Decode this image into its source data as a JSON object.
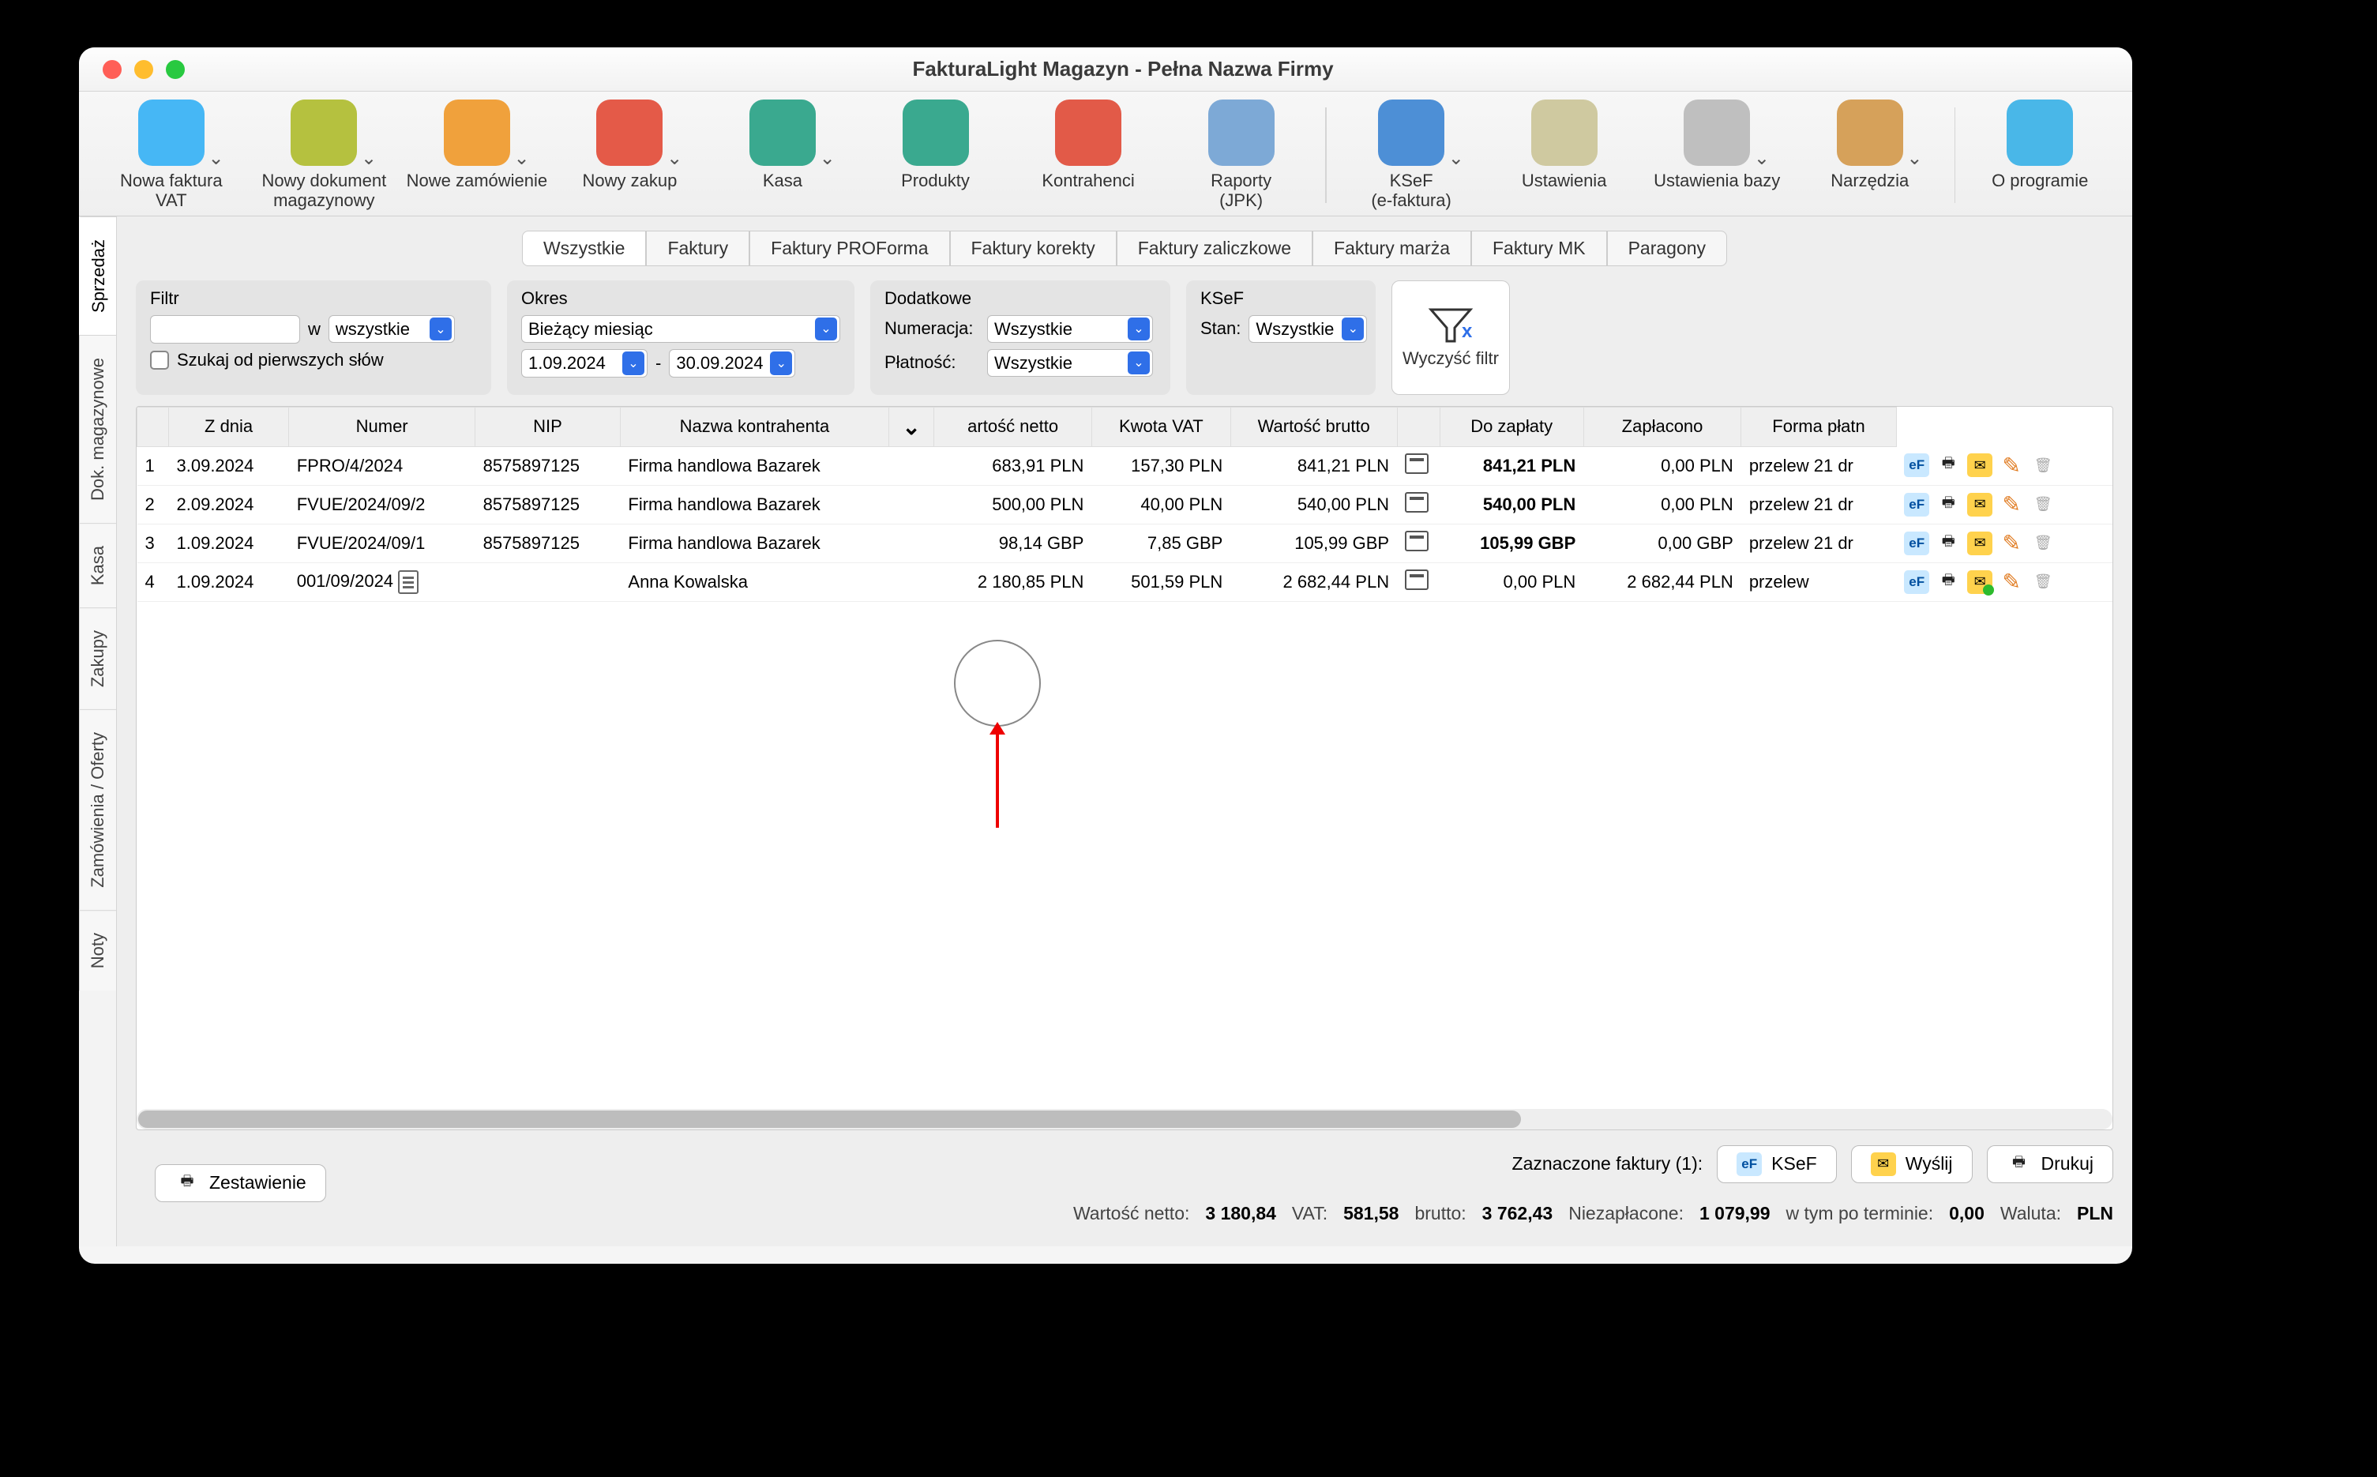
{
  "window_title": "FakturaLight Magazyn - Pełna Nazwa Firmy",
  "toolbar": [
    {
      "label": "Nowa faktura\nVAT",
      "color": "#46b7f5",
      "chev": true
    },
    {
      "label": "Nowy dokument\nmagazynowy",
      "color": "#b5c13f",
      "chev": true
    },
    {
      "label": "Nowe zamówienie",
      "color": "#f0a13c",
      "chev": true
    },
    {
      "label": "Nowy zakup",
      "color": "#e45a48",
      "chev": true
    },
    {
      "label": "Kasa",
      "color": "#3aa98f",
      "chev": true
    },
    {
      "label": "Produkty",
      "color": "#3aa98f",
      "chev": false
    },
    {
      "label": "Kontrahenci",
      "color": "#e25a48",
      "chev": false
    },
    {
      "label": "Raporty\n(JPK)",
      "color": "#7da9d6",
      "chev": false
    },
    {
      "sep": true
    },
    {
      "label": "KSeF\n(e-faktura)",
      "color": "#4d8fd6",
      "chev": true
    },
    {
      "label": "Ustawienia",
      "color": "#cfc9a0",
      "chev": false
    },
    {
      "label": "Ustawienia bazy",
      "color": "#bfbfbf",
      "chev": true
    },
    {
      "label": "Narzędzia",
      "color": "#d6a15a",
      "chev": true
    },
    {
      "sep": true
    },
    {
      "label": "O programie",
      "color": "#49b7e8",
      "chev": false
    }
  ],
  "sidetabs": [
    "Sprzedaż",
    "Dok. magazynowe",
    "Kasa",
    "Zakupy",
    "Zamówienia / Oferty",
    "Noty"
  ],
  "doc_tabs": [
    "Wszystkie",
    "Faktury",
    "Faktury PROForma",
    "Faktury korekty",
    "Faktury zaliczkowe",
    "Faktury marża",
    "Faktury MK",
    "Paragony"
  ],
  "filter": {
    "title": "Filtr",
    "in_label": "w",
    "in_select": "wszystkie",
    "search_first": "Szukaj od pierwszych słów"
  },
  "okres": {
    "title": "Okres",
    "preset": "Bieżący miesiąc",
    "from": "1.09.2024",
    "sep": "-",
    "to": "30.09.2024"
  },
  "dodatkowe": {
    "title": "Dodatkowe",
    "num_lbl": "Numeracja:",
    "num_val": "Wszystkie",
    "pay_lbl": "Płatność:",
    "pay_val": "Wszystkie"
  },
  "ksef": {
    "title": "KSeF",
    "stan_lbl": "Stan:",
    "stan_val": "Wszystkie"
  },
  "clear_filter": "Wyczyść filtr",
  "columns": [
    "",
    "Z dnia",
    "Numer",
    "NIP",
    "Nazwa kontrahenta",
    "",
    "artość netto",
    "Kwota VAT",
    "Wartość brutto",
    "",
    "Do zapłaty",
    "Zapłacono",
    "Forma płatn"
  ],
  "rows": [
    {
      "n": "1",
      "date": "3.09.2024",
      "num": "FPRO/4/2024",
      "nip": "8575897125",
      "name": "Firma handlowa Bazarek",
      "net": "683,91 PLN",
      "vat": "157,30 PLN",
      "gross": "841,21 PLN",
      "due": "841,21 PLN",
      "due_bold": true,
      "paid": "0,00 PLN",
      "form": "przelew 21 dr",
      "mail_ok": false
    },
    {
      "n": "2",
      "date": "2.09.2024",
      "num": "FVUE/2024/09/2",
      "nip": "8575897125",
      "name": "Firma handlowa Bazarek",
      "net": "500,00 PLN",
      "vat": "40,00 PLN",
      "gross": "540,00 PLN",
      "due": "540,00 PLN",
      "due_bold": true,
      "paid": "0,00 PLN",
      "form": "przelew 21 dr",
      "mail_ok": false
    },
    {
      "n": "3",
      "date": "1.09.2024",
      "num": "FVUE/2024/09/1",
      "nip": "8575897125",
      "name": "Firma handlowa Bazarek",
      "net": "98,14 GBP",
      "vat": "7,85 GBP",
      "gross": "105,99 GBP",
      "due": "105,99 GBP",
      "due_bold": true,
      "paid": "0,00 GBP",
      "form": "przelew 21 dr",
      "mail_ok": false
    },
    {
      "n": "4",
      "date": "1.09.2024",
      "num": "001/09/2024",
      "doc": true,
      "nip": "",
      "name": "Anna Kowalska",
      "net": "2 180,85 PLN",
      "vat": "501,59 PLN",
      "gross": "2 682,44 PLN",
      "due": "0,00 PLN",
      "due_bold": false,
      "paid": "2 682,44 PLN",
      "form": "przelew",
      "mail_ok": true
    }
  ],
  "selected_label": "Zaznaczone faktury (1):",
  "btn_ksef": "KSeF",
  "btn_send": "Wyślij",
  "btn_print": "Drukuj",
  "btn_zest": "Zestawienie",
  "totals": {
    "net_k": "Wartość netto:",
    "net_v": "3 180,84",
    "vat_k": "VAT:",
    "vat_v": "581,58",
    "gross_k": "brutto:",
    "gross_v": "3 762,43",
    "unpaid_k": "Niezapłacone:",
    "unpaid_v": "1 079,99",
    "term_k": "w tym po terminie:",
    "term_v": "0,00",
    "cur_k": "Waluta:",
    "cur_v": "PLN"
  }
}
